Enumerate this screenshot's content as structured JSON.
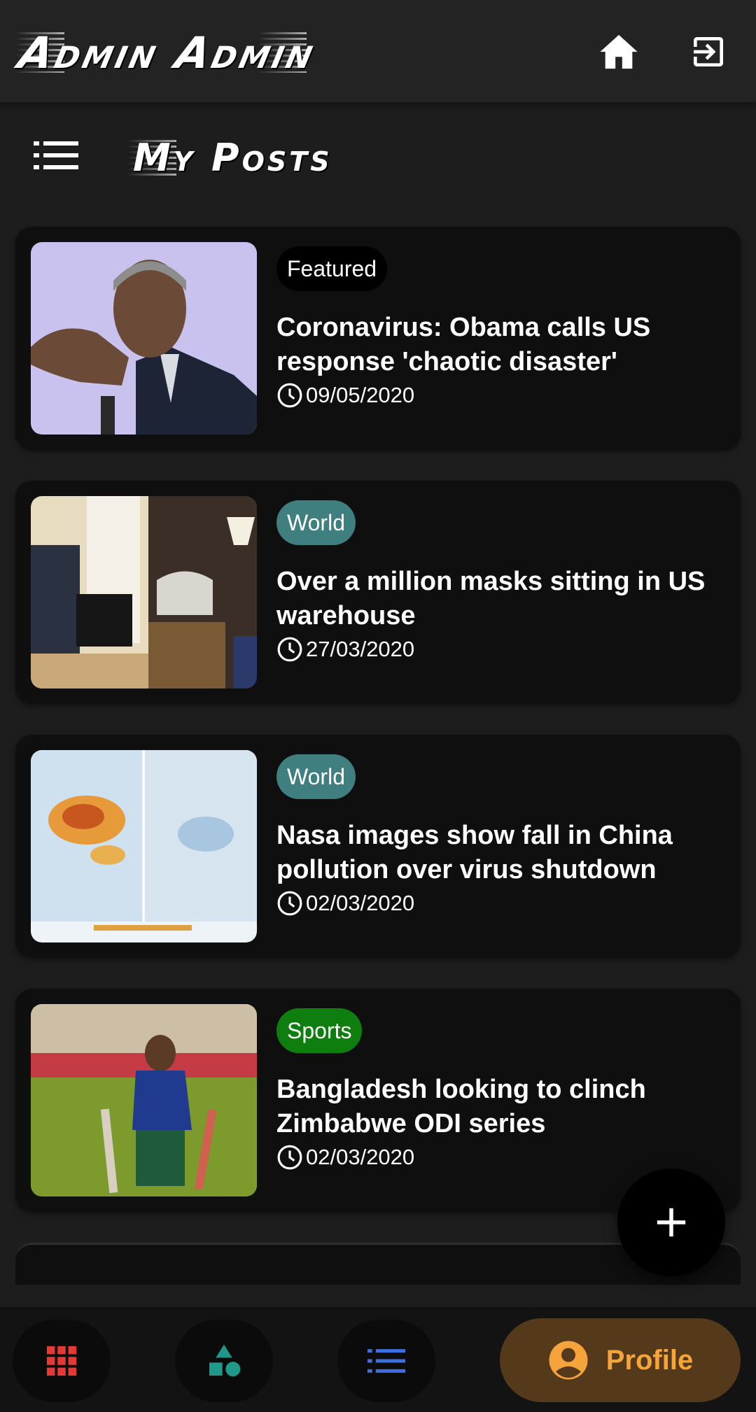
{
  "header": {
    "brand": "Admin Admin",
    "home_icon": "home-icon",
    "logout_icon": "logout-icon"
  },
  "page": {
    "title": "My Posts",
    "menu_icon": "list-menu-icon"
  },
  "posts": [
    {
      "category": "Featured",
      "category_color": "#000000",
      "title": "Coronavirus: Obama calls US response 'chaotic disaster'",
      "date": "09/05/2020"
    },
    {
      "category": "World",
      "category_color": "#3f7f7f",
      "title": "Over a million masks sitting in US warehouse",
      "date": "27/03/2020"
    },
    {
      "category": "World",
      "category_color": "#3f7f7f",
      "title": "Nasa images show fall in China pollution over virus shutdown",
      "date": "02/03/2020"
    },
    {
      "category": "Sports",
      "category_color": "#0e7f0e",
      "title": "Bangladesh looking to clinch Zimbabwe ODI series",
      "date": "02/03/2020"
    }
  ],
  "fab": {
    "icon": "plus-icon"
  },
  "bottom_nav": {
    "items": [
      {
        "icon": "grid-icon",
        "color": "#e53935"
      },
      {
        "icon": "shapes-icon",
        "color": "#1f9a8a"
      },
      {
        "icon": "list-icon",
        "color": "#3d6fe0"
      }
    ],
    "active": {
      "icon": "account-circle-icon",
      "label": "Profile",
      "color": "#f5a33b"
    }
  }
}
